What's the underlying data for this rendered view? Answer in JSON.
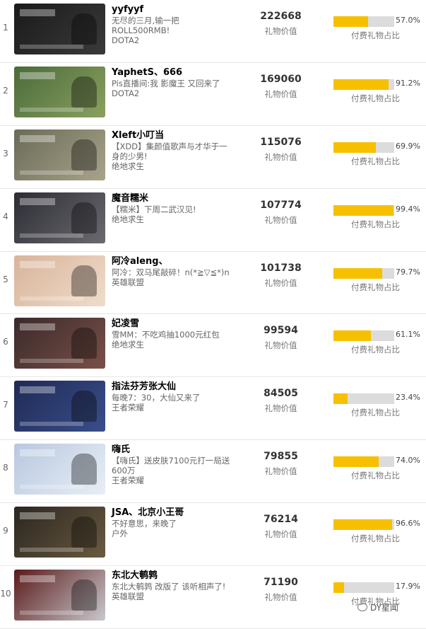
{
  "columns": {
    "gift_label": "礼物价值",
    "pay_label": "付费礼物占比"
  },
  "colors": {
    "bar_fill": "#f6c000",
    "bar_track": "#dcdcdc"
  },
  "watermark": "DY星闻",
  "rows": [
    {
      "rank": "1",
      "name": "yyfyyf",
      "title": "无尽的三月,输一把ROLL500RMB!",
      "category": "DOTA2",
      "gift_value": "222668",
      "pay_pct": "57.0%",
      "pay_ratio": 0.57,
      "thumb_colors": [
        "#1a1a1a",
        "#3a3a3a"
      ]
    },
    {
      "rank": "2",
      "name": "YaphetS、666",
      "title": "Pis直播间:我 影魔王 又回来了",
      "category": "DOTA2",
      "gift_value": "169060",
      "pay_pct": "91.2%",
      "pay_ratio": 0.912,
      "thumb_colors": [
        "#4b6b3a",
        "#8aa060"
      ]
    },
    {
      "rank": "3",
      "name": "Xleft小叮当",
      "title": "【XDD】集颜值歌声与才华于一身的少男!",
      "category": "绝地求生",
      "gift_value": "115076",
      "pay_pct": "69.9%",
      "pay_ratio": 0.699,
      "thumb_colors": [
        "#6a6a58",
        "#a8a48a"
      ]
    },
    {
      "rank": "4",
      "name": "魔音糯米",
      "title": "【糯米】下周二武汉见!",
      "category": "绝地求生",
      "gift_value": "107774",
      "pay_pct": "99.4%",
      "pay_ratio": 0.994,
      "thumb_colors": [
        "#2c2c34",
        "#6b6a70"
      ]
    },
    {
      "rank": "5",
      "name": "阿冷aleng、",
      "title": "阿冷：双马尾敲碎！n(*≧▽≦*)n",
      "category": "英雄联盟",
      "gift_value": "101738",
      "pay_pct": "79.7%",
      "pay_ratio": 0.797,
      "thumb_colors": [
        "#d8b49a",
        "#f0dccb"
      ]
    },
    {
      "rank": "6",
      "name": "妃凌雪",
      "title": "雪MM：不吃鸡抽1000元红包",
      "category": "绝地求生",
      "gift_value": "99594",
      "pay_pct": "61.1%",
      "pay_ratio": 0.611,
      "thumb_colors": [
        "#3a2a2a",
        "#7a5048"
      ]
    },
    {
      "rank": "7",
      "name": "指法芬芳张大仙",
      "title": "每晚7：30，大仙又来了",
      "category": "王者荣耀",
      "gift_value": "84505",
      "pay_pct": "23.4%",
      "pay_ratio": 0.234,
      "thumb_colors": [
        "#1f2a55",
        "#3a4e8a"
      ]
    },
    {
      "rank": "8",
      "name": "嗨氏",
      "title": "【嗨氏】送皮肤7100元打一局送600万",
      "category": "王者荣耀",
      "gift_value": "79855",
      "pay_pct": "74.0%",
      "pay_ratio": 0.74,
      "thumb_colors": [
        "#b8c8e0",
        "#e8eef6"
      ]
    },
    {
      "rank": "9",
      "name": "JSA、北京小王哥",
      "title": "不好意思，来晚了",
      "category": "户外",
      "gift_value": "76214",
      "pay_pct": "96.6%",
      "pay_ratio": 0.966,
      "thumb_colors": [
        "#2a2620",
        "#6a5a40"
      ]
    },
    {
      "rank": "10",
      "name": "东北大鹌鹑",
      "title": "东北大鹌鹑 改版了 该听相声了!",
      "category": "英雄联盟",
      "gift_value": "71190",
      "pay_pct": "17.9%",
      "pay_ratio": 0.179,
      "thumb_colors": [
        "#5a1a1a",
        "#c8c8cc"
      ]
    }
  ]
}
